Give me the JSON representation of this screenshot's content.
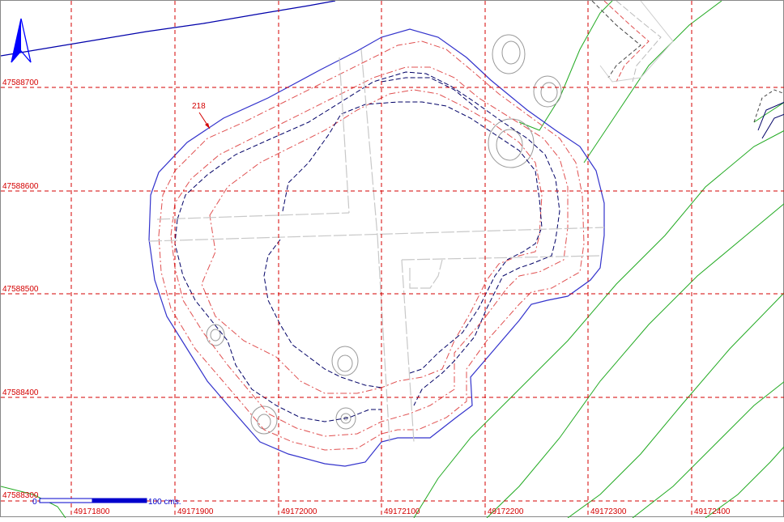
{
  "north_arrow": {
    "icon": "north-arrow-icon",
    "color": "#0000ff"
  },
  "grid": {
    "color": "#d40000",
    "x_labels": [
      "49171800",
      "49171900",
      "49172000",
      "49172100",
      "49172200",
      "49172300",
      "49172400"
    ],
    "y_labels": [
      "47588700",
      "47588600",
      "47588500",
      "47588400",
      "47588300"
    ]
  },
  "contour_label": "218",
  "scale_bar": {
    "start_label": "0",
    "end_label": "100 cms."
  },
  "colors": {
    "outline": "#3333cc",
    "contour_red": "#e05050",
    "contour_dark": "#000066",
    "access_lines": "#c0c0c0",
    "vegetation": "#22aa22",
    "rocks": "#999999"
  }
}
